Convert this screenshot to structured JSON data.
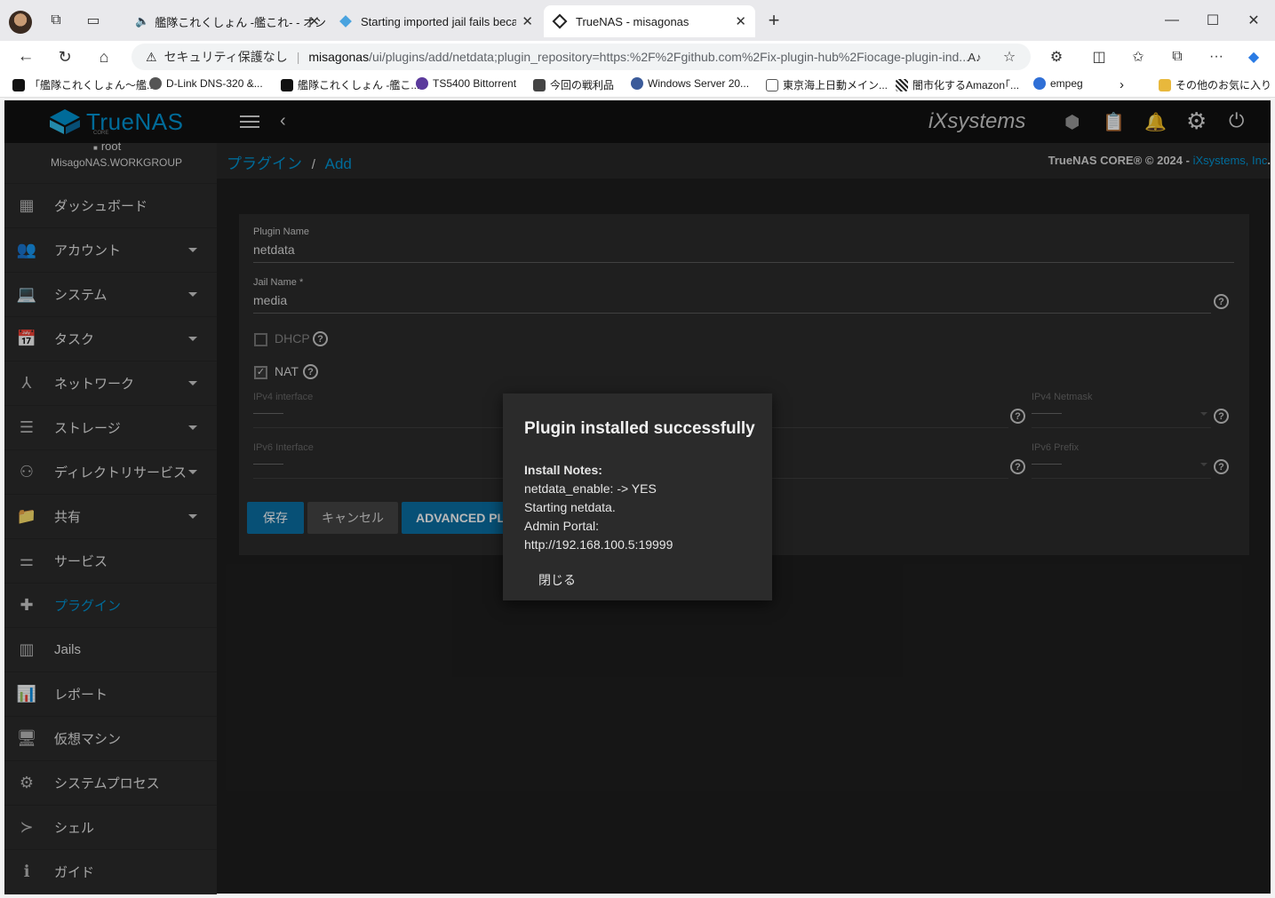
{
  "browser": {
    "tabs": [
      {
        "title": "艦隊これくしょん -艦これ- - オン"
      },
      {
        "title": "Starting imported jail fails becaus"
      },
      {
        "title": "TrueNAS - misagonas"
      }
    ],
    "security_label": "セキュリティ保護なし",
    "url_host": "misagonas",
    "url_path": "/ui/plugins/add/netdata;plugin_repository=https:%2F%2Fgithub.com%2Fix-plugin-hub%2Fiocage-plugin-ind...",
    "bookmarks": [
      "「艦隊これくしょん～艦...",
      "D-Link DNS-320 &...",
      "艦隊これくしょん -艦こ...",
      "TS5400 Bittorrent",
      "今回の戦利品",
      "Windows Server 20...",
      "東京海上日動メイン...",
      "闇市化するAmazon｢...",
      "empeg"
    ],
    "other_bookmarks": "その他のお気に入り"
  },
  "app": {
    "logo_text": "TrueNAS",
    "logo_sub": "CORE",
    "vendor_logo": "iXsystems",
    "user": "root",
    "hostname": "MisagoNAS.WORKGROUP",
    "breadcrumb": [
      "プラグイン",
      "Add"
    ],
    "copyright_prefix": "TrueNAS CORE® © 2024 - ",
    "copyright_link": "iXsystems, Inc",
    "copyright_suffix": "."
  },
  "nav": [
    {
      "label": "ダッシュボード",
      "icon": "dashboard-icon",
      "expand": false,
      "selected": false
    },
    {
      "label": "アカウント",
      "icon": "people-icon",
      "expand": true,
      "selected": false
    },
    {
      "label": "システム",
      "icon": "laptop-icon",
      "expand": true,
      "selected": false
    },
    {
      "label": "タスク",
      "icon": "calendar-icon",
      "expand": true,
      "selected": false
    },
    {
      "label": "ネットワーク",
      "icon": "network-icon",
      "expand": true,
      "selected": false
    },
    {
      "label": "ストレージ",
      "icon": "storage-icon",
      "expand": true,
      "selected": false
    },
    {
      "label": "ディレクトリサービス",
      "icon": "directory-icon",
      "expand": true,
      "selected": false
    },
    {
      "label": "共有",
      "icon": "share-folder-icon",
      "expand": true,
      "selected": false
    },
    {
      "label": "サービス",
      "icon": "tune-icon",
      "expand": false,
      "selected": false
    },
    {
      "label": "プラグイン",
      "icon": "puzzle-icon",
      "expand": false,
      "selected": true
    },
    {
      "label": "Jails",
      "icon": "jail-icon",
      "expand": false,
      "selected": false
    },
    {
      "label": "レポート",
      "icon": "report-icon",
      "expand": false,
      "selected": false
    },
    {
      "label": "仮想マシン",
      "icon": "vm-icon",
      "expand": false,
      "selected": false
    },
    {
      "label": "システムプロセス",
      "icon": "process-icon",
      "expand": false,
      "selected": false
    },
    {
      "label": "シェル",
      "icon": "shell-icon",
      "expand": false,
      "selected": false
    },
    {
      "label": "ガイド",
      "icon": "info-icon",
      "expand": false,
      "selected": false
    }
  ],
  "form": {
    "plugin_name_label": "Plugin Name",
    "plugin_name_value": "netdata",
    "jail_name_label": "Jail Name *",
    "jail_name_value": "media",
    "dhcp_label": "DHCP",
    "dhcp_checked": false,
    "nat_label": "NAT",
    "nat_checked": true,
    "ipv4_interface_label": "IPv4 interface",
    "ipv4_netmask_label": "IPv4 Netmask",
    "ipv6_interface_label": "IPv6 Interface",
    "ipv6_prefix_label": "IPv6 Prefix",
    "save_label": "保存",
    "cancel_label": "キャンセル",
    "advanced_label": "ADVANCED PLUGIN INSTALLATION"
  },
  "dialog": {
    "title": "Plugin installed successfully",
    "notes_heading": "Install Notes:",
    "lines": [
      "netdata_enable: -> YES",
      "Starting netdata.",
      "Admin Portal:",
      "http://192.168.100.5:19999"
    ],
    "close_label": "閉じる"
  },
  "colors": {
    "accent": "#0095d5",
    "button_primary": "#0b6fa4",
    "button_secondary": "#444444",
    "background": "#1e1e1e"
  }
}
